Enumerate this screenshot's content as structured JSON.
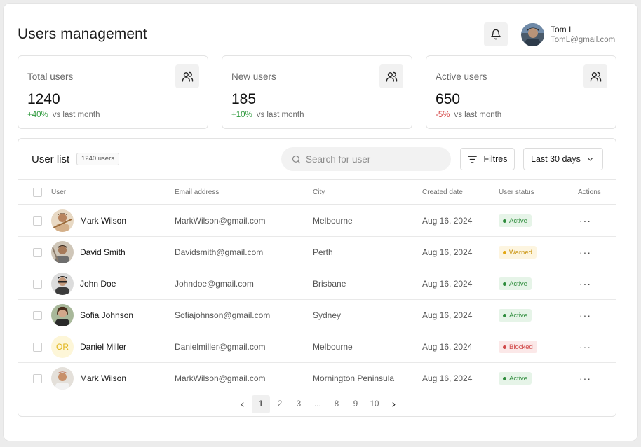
{
  "header": {
    "title": "Users management",
    "user": {
      "name": "Tom I",
      "email": "TomL@gmail.com"
    }
  },
  "stats": [
    {
      "label": "Total users",
      "value": "1240",
      "delta": "+40%",
      "delta_dir": "up",
      "delta_suffix": "vs last month"
    },
    {
      "label": "New users",
      "value": "185",
      "delta": "+10%",
      "delta_dir": "up",
      "delta_suffix": "vs last month"
    },
    {
      "label": "Active users",
      "value": "650",
      "delta": "-5%",
      "delta_dir": "down",
      "delta_suffix": "vs last month"
    }
  ],
  "user_list": {
    "title": "User list",
    "count_badge": "1240 users",
    "search_placeholder": "Search for user",
    "filter_label": "Filtres",
    "range_label": "Last 30 days",
    "columns": [
      "User",
      "Email address",
      "City",
      "Created date",
      "User status",
      "Actions"
    ],
    "rows": [
      {
        "name": "Mark Wilson",
        "email": "MarkWilson@gmail.com",
        "city": "Melbourne",
        "created": "Aug 16, 2024",
        "status": "Active"
      },
      {
        "name": "David Smith",
        "email": "Davidsmith@gmail.com",
        "city": "Perth",
        "created": "Aug 16, 2024",
        "status": "Warned"
      },
      {
        "name": "John Doe",
        "email": "Johndoe@gmail.com",
        "city": "Brisbane",
        "created": "Aug 16, 2024",
        "status": "Active"
      },
      {
        "name": "Sofia Johnson",
        "email": "Sofiajohnson@gmail.com",
        "city": "Sydney",
        "created": "Aug 16, 2024",
        "status": "Active"
      },
      {
        "name": "Daniel Miller",
        "email": "Danielmiller@gmail.com",
        "city": "Melbourne",
        "created": "Aug 16, 2024",
        "status": "Blocked",
        "initials": "OR"
      },
      {
        "name": "Mark Wilson",
        "email": "MarkWilson@gmail.com",
        "city": "Mornington Peninsula",
        "created": "Aug 16, 2024",
        "status": "Active"
      }
    ],
    "actions_glyph": "···"
  },
  "pagination": {
    "pages": [
      "1",
      "2",
      "3",
      "...",
      "8",
      "9",
      "10"
    ],
    "current": "1"
  },
  "colors": {
    "positive": "#2f9a3e",
    "negative": "#d23c3c",
    "active": "#2e8c3c",
    "warned": "#e3a712",
    "blocked": "#d04848"
  }
}
